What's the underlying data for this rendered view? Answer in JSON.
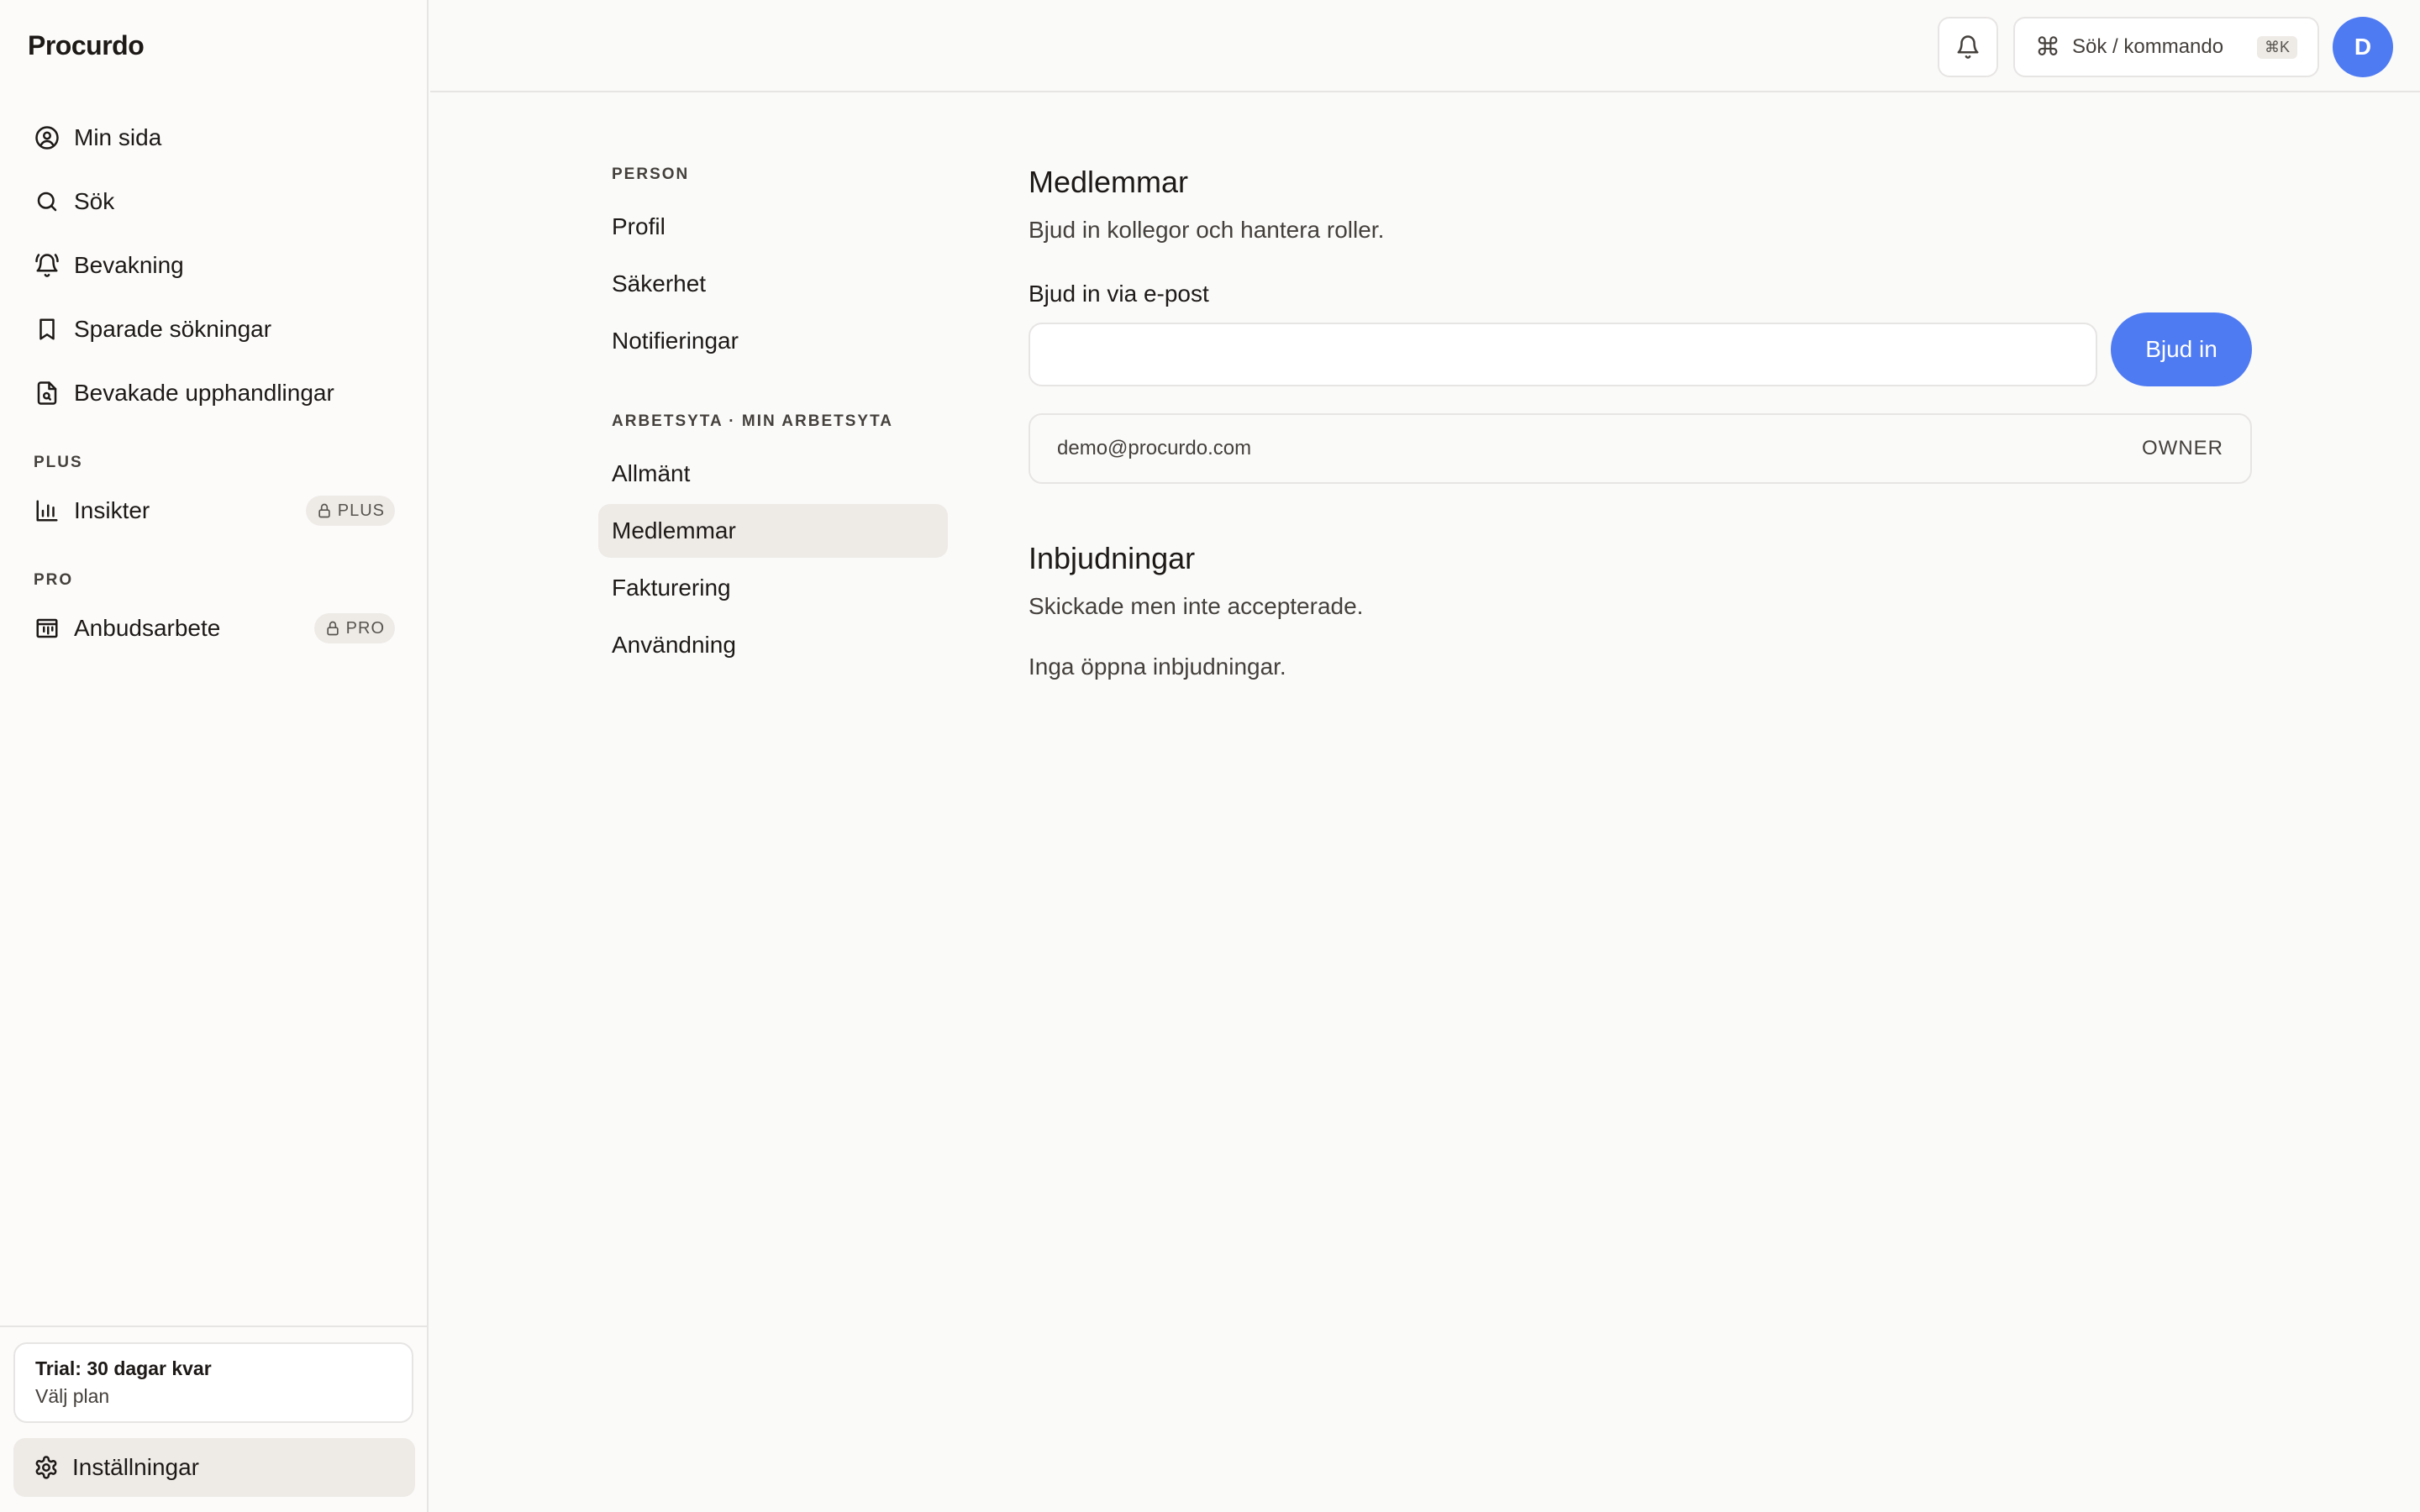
{
  "app": {
    "brand": "Procurdo"
  },
  "sidebar": {
    "items": [
      {
        "label": "Min sida",
        "icon": "user-circle-icon"
      },
      {
        "label": "Sök",
        "icon": "search-icon"
      },
      {
        "label": "Bevakning",
        "icon": "bell-ring-icon"
      },
      {
        "label": "Sparade sökningar",
        "icon": "bookmark-icon"
      },
      {
        "label": "Bevakade upphandlingar",
        "icon": "file-search-icon"
      }
    ],
    "plus_section": "PLUS",
    "plus_item": {
      "label": "Insikter",
      "badge": "PLUS",
      "icon": "bar-chart-icon"
    },
    "pro_section": "PRO",
    "pro_item": {
      "label": "Anbudsarbete",
      "badge": "PRO",
      "icon": "kanban-icon"
    },
    "trial": {
      "title": "Trial: 30 dagar kvar",
      "action": "Välj plan"
    },
    "settings_label": "Inställningar"
  },
  "header": {
    "command_label": "Sök / kommando",
    "shortcut": "⌘K",
    "avatar_initial": "D"
  },
  "subnav": {
    "person_label": "PERSON",
    "person_items": [
      "Profil",
      "Säkerhet",
      "Notifieringar"
    ],
    "workspace_label": "ARBETSYTA · MIN ARBETSYTA",
    "workspace_items": [
      "Allmänt",
      "Medlemmar",
      "Fakturering",
      "Användning"
    ],
    "active": "Medlemmar"
  },
  "members": {
    "title": "Medlemmar",
    "description": "Bjud in kollegor och hantera roller.",
    "invite_label": "Bjud in via e-post",
    "invite_value": "",
    "invite_button": "Bjud in",
    "list": [
      {
        "email": "demo@procurdo.com",
        "role": "OWNER"
      }
    ]
  },
  "invitations": {
    "title": "Inbjudningar",
    "description": "Skickade men inte accepterade.",
    "empty": "Inga öppna inbjudningar."
  },
  "colors": {
    "accent": "#4f7bf2",
    "active_bg": "#eeebe7",
    "border": "#e7e5e4"
  }
}
